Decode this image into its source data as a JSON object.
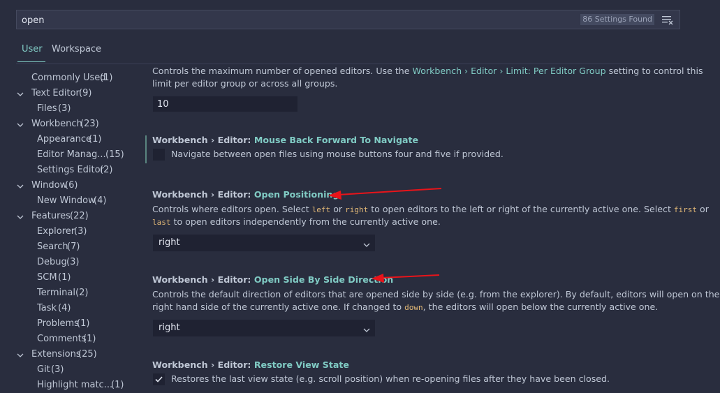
{
  "search": {
    "value": "open",
    "results_count": "86 Settings Found"
  },
  "tabs": [
    {
      "label": "User"
    },
    {
      "label": "Workspace"
    }
  ],
  "toc": [
    {
      "label": "Commonly Used",
      "count": "(1)"
    },
    {
      "label": "Text Editor",
      "count": "(9)"
    },
    {
      "label": "Files",
      "count": "(3)"
    },
    {
      "label": "Workbench",
      "count": "(23)"
    },
    {
      "label": "Appearance",
      "count": "(1)"
    },
    {
      "label": "Editor Manag...",
      "count": "(15)"
    },
    {
      "label": "Settings Editor",
      "count": "(2)"
    },
    {
      "label": "Window",
      "count": "(6)"
    },
    {
      "label": "New Window",
      "count": "(4)"
    },
    {
      "label": "Features",
      "count": "(22)"
    },
    {
      "label": "Explorer",
      "count": "(3)"
    },
    {
      "label": "Search",
      "count": "(7)"
    },
    {
      "label": "Debug",
      "count": "(3)"
    },
    {
      "label": "SCM",
      "count": "(1)"
    },
    {
      "label": "Terminal",
      "count": "(2)"
    },
    {
      "label": "Task",
      "count": "(4)"
    },
    {
      "label": "Problems",
      "count": "(1)"
    },
    {
      "label": "Comments",
      "count": "(1)"
    },
    {
      "label": "Extensions",
      "count": "(25)"
    },
    {
      "label": "Git",
      "count": "(3)"
    },
    {
      "label": "Highlight matc...",
      "count": "(1)"
    }
  ],
  "settings": {
    "limit": {
      "desc_line1_a": "Controls the maximum number of opened editors. Use the ",
      "desc_line1_link": "Workbench › Editor › Limit: Per Editor Group",
      "desc_line1_b": " setting to control this",
      "desc_line2": "limit per editor group or across all groups.",
      "value": "10"
    },
    "mouse_nav": {
      "prefix": "Workbench › Editor: ",
      "name": "Mouse Back Forward To Navigate",
      "desc": "Navigate between open files using mouse buttons four and five if provided."
    },
    "open_positioning": {
      "prefix": "Workbench › Editor: ",
      "name": "Open Positioning",
      "desc_1": "Controls where editors open. Select ",
      "code_left": "left",
      "desc_2": " or ",
      "code_right": "right",
      "desc_3": " to open editors to the left or right of the currently active one. Select ",
      "code_first": "first",
      "desc_4": " or",
      "code_last": "last",
      "desc_5": " to open editors independently from the currently active one.",
      "value": "right"
    },
    "side_by_side": {
      "prefix": "Workbench › Editor: ",
      "name": "Open Side By Side Direction",
      "desc_line1": "Controls the default direction of editors that are opened side by side (e.g. from the explorer). By default, editors will open on the",
      "desc_2a": "right hand side of the currently active one. If changed to ",
      "code_down": "down",
      "desc_2b": ", the editors will open below the currently active one.",
      "value": "right"
    },
    "restore_view": {
      "prefix": "Workbench › Editor: ",
      "name": "Restore View State",
      "desc": "Restores the last view state (e.g. scroll position) when re-opening files after they have been closed."
    }
  },
  "colors": {
    "background": "#292d3e",
    "accent": "#80cbc4",
    "annotation_arrow": "#e8141a",
    "code": "#e3b977"
  },
  "icons": {
    "filter": "clear-filter-icon",
    "chevron": "chevron-down-icon",
    "check": "check-icon",
    "annotation": "red-arrow"
  }
}
